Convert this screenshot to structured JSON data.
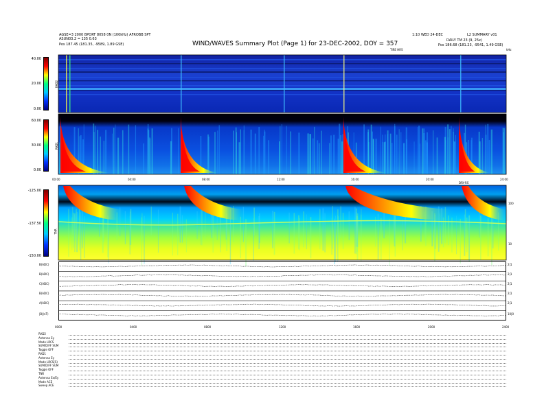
{
  "header": {
    "title": "WIND/WAVES Summary Plot (Page 1) for 23-DEC-2002, DOY = 357",
    "left_line1": "AGSE=3 2000 BPORT 8058 0N (100kHz) AFROBB SPT",
    "left_line2": "ASUN03.2 = 135 0.63",
    "left_pos": "Pos   187.45 (181.35, -9589, 1.89 GSE)",
    "right_line1": "1:10 WED 24-DEC",
    "right_line2": "L2 SUMMARY v01",
    "right_line3": "DAILY TM 23 (9, 25x)",
    "right_pos": "Pos   186.68 (181.23, -9541, 1.49 GSE)",
    "top_axis_label": "TIRE HRS",
    "top_axis_unit": "kHz",
    "mid_axis_right_label": "DRY-RS"
  },
  "chart_data": [
    {
      "type": "heatmap",
      "name": "RAD2",
      "ylabel": "RAD2",
      "colorbar_ticks": [
        "40.00",
        "20.00",
        "0.00"
      ],
      "colorbar_range": [
        0,
        40
      ]
    },
    {
      "type": "heatmap",
      "name": "RAD1",
      "ylabel": "RAD1",
      "colorbar_ticks": [
        "60.00",
        "30.00",
        "0.00"
      ],
      "colorbar_range": [
        0,
        60
      ],
      "x_ticks": [
        "00:00",
        "04:00",
        "08:00",
        "12:00",
        "16:00",
        "20:00",
        "24:00"
      ]
    },
    {
      "type": "heatmap",
      "name": "TNR",
      "ylabel": "TNR",
      "colorbar_ticks": [
        "-125.00",
        "-137.50",
        "-150.00"
      ],
      "colorbar_range": [
        -150,
        -125
      ],
      "right_ticks": [
        "100",
        "10"
      ]
    },
    {
      "type": "line",
      "name": "housekeeping",
      "rows": [
        {
          "label": "B(ADC)",
          "right": "2|1"
        },
        {
          "label": "B(ADC)",
          "right": "2|1"
        },
        {
          "label": "C(ADC)",
          "right": "2|1"
        },
        {
          "label": "B(ADC)",
          "right": "2|1"
        },
        {
          "label": "A(ADC)",
          "right": "2|1"
        },
        {
          "label": "|B|(nT)",
          "right": "10|0"
        }
      ],
      "x_ticks": [
        "0000",
        "0400",
        "0800",
        "1200",
        "1600",
        "2000",
        "2400"
      ]
    }
  ],
  "footer": {
    "lines": [
      "RAD2",
      "Antenna    Ey",
      "Mode     LRCS",
      "SUM/DIFF SUM",
      "Toggle    OFF",
      "RAD1",
      "Antenna    Ey",
      "Mode  LRCS(S)",
      "SUM/DIFF SUM",
      "Toggle    OFF",
      "TNR",
      "Antenna  Ex/Ey",
      "Mode     ACE",
      "Sweep    ACE"
    ]
  }
}
